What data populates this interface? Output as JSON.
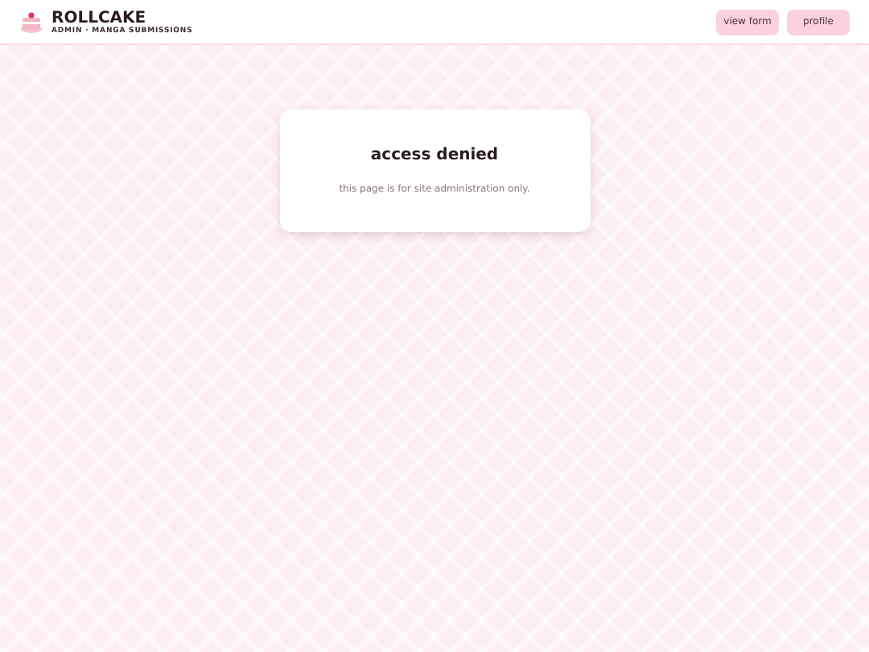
{
  "header": {
    "brand": "ROLLCAKE",
    "subtitle": "ADMIN · MANGA SUBMISSIONS",
    "buttons": [
      "view form",
      "profile"
    ]
  },
  "card": {
    "title": "access denied",
    "message": "this page is for site administration only."
  }
}
